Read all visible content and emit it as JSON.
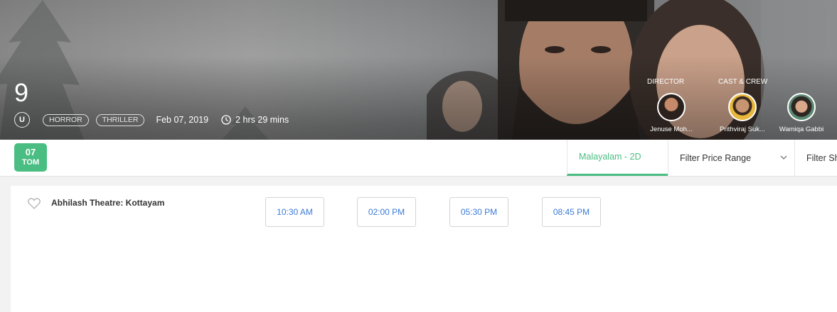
{
  "movie": {
    "title": "9",
    "certificate": "U",
    "genres": [
      "HORROR",
      "THRILLER"
    ],
    "release_date": "Feb 07, 2019",
    "duration": "2 hrs 29 mins"
  },
  "crew": {
    "director_label": "DIRECTOR",
    "cast_label": "CAST & CREW",
    "people": [
      {
        "name": "Jenuse Moh..."
      },
      {
        "name": "Prithviraj Suk..."
      },
      {
        "name": "Wamiqa Gabbi"
      }
    ]
  },
  "date_selector": {
    "day": "07",
    "weekday": "TOM"
  },
  "filters": {
    "language": "Malayalam - 2D",
    "price": "Filter Price Range",
    "show": "Filter Sh"
  },
  "listing": {
    "theatre": "Abhilash Theatre: Kottayam",
    "showtimes": [
      "10:30 AM",
      "02:00 PM",
      "05:30 PM",
      "08:45 PM"
    ]
  },
  "colors": {
    "accent": "#4abd82",
    "showtime_text": "#3b7bd8"
  }
}
